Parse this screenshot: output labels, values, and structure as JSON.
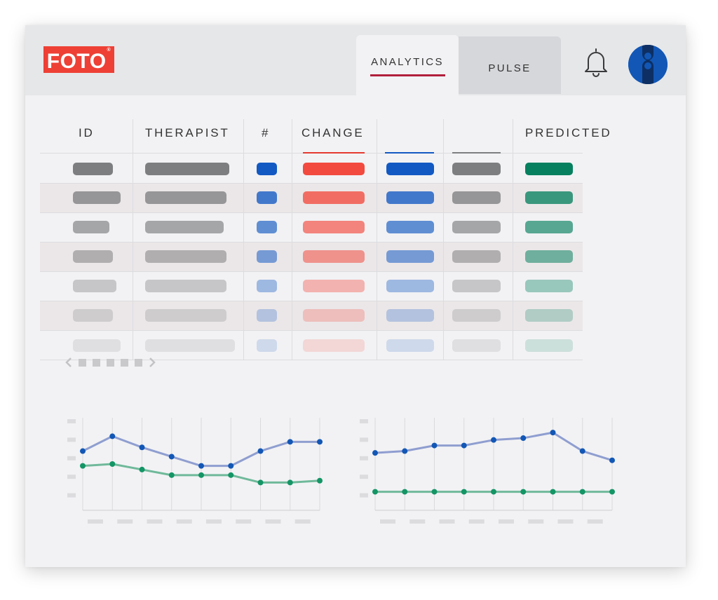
{
  "app": {
    "logo_text": "FOTO",
    "logo_mark": "®"
  },
  "tabs": [
    {
      "label": "ANALYTICS",
      "active": true
    },
    {
      "label": "PULSE",
      "active": false
    }
  ],
  "icons": {
    "notifications": "bell-icon",
    "avatar": "user-avatar-icon"
  },
  "table": {
    "headers": [
      "ID",
      "THERAPIST",
      "#",
      "CHANGE",
      "",
      "",
      "PREDICTED"
    ],
    "row_count": 7,
    "column_colors": [
      "#7d7e80",
      "#7d7e80",
      "#1259c3",
      "#f24a3f",
      "#1259c3",
      "#7d7e80",
      "#06805f"
    ]
  },
  "pager": {
    "prev_icon": "chevron-left-icon",
    "next_icon": "chevron-right-icon",
    "dots": 5
  },
  "colors": {
    "accent": "#b21f3b",
    "brand": "#ee4035",
    "blue_series": "#1257b5",
    "green_series": "#149566"
  },
  "chart_data": [
    {
      "type": "line",
      "x": [
        1,
        2,
        3,
        4,
        5,
        6,
        7,
        8,
        9
      ],
      "ylim": [
        0,
        5
      ],
      "grid": true,
      "series": [
        {
          "values": [
            3.2,
            4.0,
            3.4,
            2.9,
            2.4,
            2.4,
            3.2,
            3.7,
            3.7
          ]
        },
        {
          "values": [
            2.4,
            2.5,
            2.2,
            1.9,
            1.9,
            1.9,
            1.5,
            1.5,
            1.6
          ]
        }
      ]
    },
    {
      "type": "line",
      "x": [
        1,
        2,
        3,
        4,
        5,
        6,
        7,
        8,
        9
      ],
      "ylim": [
        0,
        5
      ],
      "grid": true,
      "series": [
        {
          "values": [
            3.1,
            3.2,
            3.5,
            3.5,
            3.8,
            3.9,
            4.2,
            3.2,
            2.7
          ]
        },
        {
          "values": [
            1.0,
            1.0,
            1.0,
            1.0,
            1.0,
            1.0,
            1.0,
            1.0,
            1.0
          ]
        }
      ]
    }
  ]
}
